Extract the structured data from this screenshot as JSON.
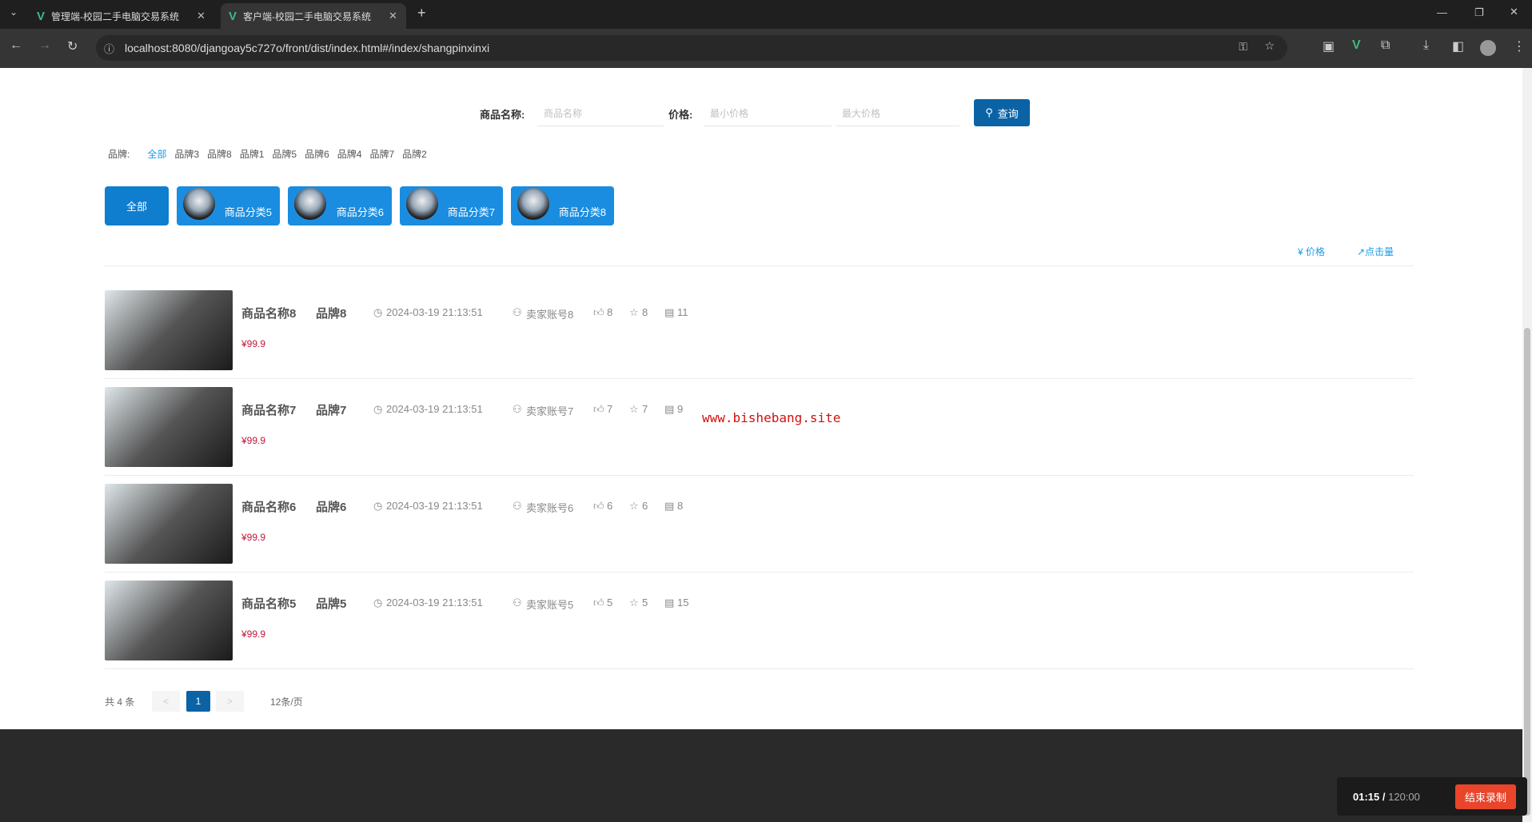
{
  "browser": {
    "tabs": [
      {
        "title": "管理端-校园二手电脑交易系统"
      },
      {
        "title": "客户端-校园二手电脑交易系统"
      }
    ],
    "url": "localhost:8080/djangoay5c727o/front/dist/index.html#/index/shangpinxinxi"
  },
  "search": {
    "name_label": "商品名称:",
    "name_placeholder": "商品名称",
    "price_label": "价格:",
    "min_placeholder": "最小价格",
    "max_placeholder": "最大价格",
    "button": "查询"
  },
  "brands": {
    "label": "品牌:",
    "items": [
      "全部",
      "品牌3",
      "品牌8",
      "品牌1",
      "品牌5",
      "品牌6",
      "品牌4",
      "品牌7",
      "品牌2"
    ]
  },
  "categories": [
    "全部",
    "商品分类5",
    "商品分类6",
    "商品分类7",
    "商品分类8"
  ],
  "sort": {
    "price": "¥ 价格",
    "clicks": "点击量"
  },
  "products": [
    {
      "name": "商品名称8",
      "brand": "品牌8",
      "time": "2024-03-19 21:13:51",
      "seller": "卖家账号8",
      "likes": "8",
      "stars": "8",
      "comments": "11",
      "price": "¥99.9"
    },
    {
      "name": "商品名称7",
      "brand": "品牌7",
      "time": "2024-03-19 21:13:51",
      "seller": "卖家账号7",
      "likes": "7",
      "stars": "7",
      "comments": "9",
      "price": "¥99.9"
    },
    {
      "name": "商品名称6",
      "brand": "品牌6",
      "time": "2024-03-19 21:13:51",
      "seller": "卖家账号6",
      "likes": "6",
      "stars": "6",
      "comments": "8",
      "price": "¥99.9"
    },
    {
      "name": "商品名称5",
      "brand": "品牌5",
      "time": "2024-03-19 21:13:51",
      "seller": "卖家账号5",
      "likes": "5",
      "stars": "5",
      "comments": "15",
      "price": "¥99.9"
    }
  ],
  "watermark": "www.bishebang.site",
  "pagination": {
    "total": "共 4 条",
    "prev": "<",
    "page": "1",
    "next": ">",
    "size": "12条/页"
  },
  "recorder": {
    "elapsed": "01:15 /",
    "limit": "120:00",
    "stop": "结束录制"
  }
}
